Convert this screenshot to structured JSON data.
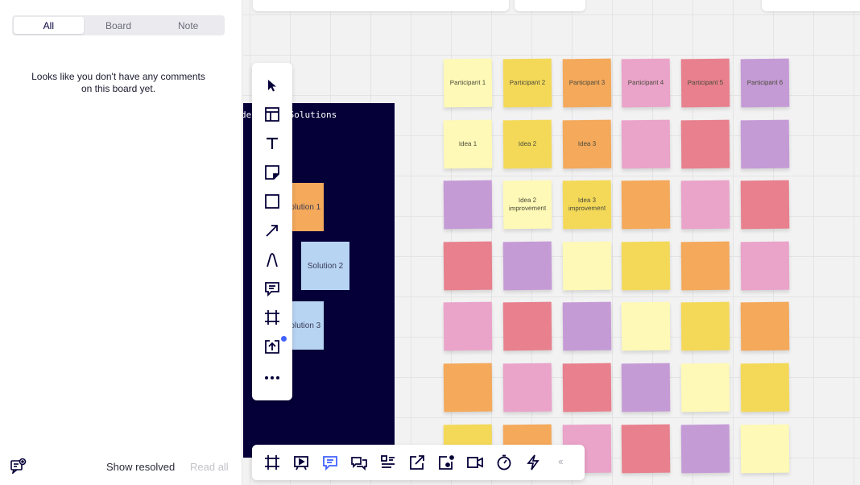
{
  "comments_panel": {
    "tabs": [
      {
        "label": "All",
        "active": true
      },
      {
        "label": "Board",
        "active": false
      },
      {
        "label": "Note",
        "active": false
      }
    ],
    "empty_message_line1": "Looks like you don't have any comments",
    "empty_message_line2": "on this board yet.",
    "show_resolved": "Show resolved",
    "read_all": "Read all"
  },
  "frame": {
    "title": "Ideas and Solutions",
    "title_visible": "deas and Solutions",
    "solutions": [
      "Solution 1",
      "Solution 2",
      "Solution 3"
    ]
  },
  "colors": {
    "light_yellow": "#fef9b6",
    "yellow": "#f4d959",
    "orange": "#f4a95b",
    "pink": "#eaa3c9",
    "red": "#e8808e",
    "violet": "#c59bd6",
    "blue": "#b7d4f3",
    "frame": "#050038",
    "accent": "#4262ff"
  },
  "sticky_grid": [
    [
      {
        "c": "light_yellow",
        "t": "Participant 1"
      },
      {
        "c": "yellow",
        "t": "Participant 2"
      },
      {
        "c": "orange",
        "t": "Participant 3"
      },
      {
        "c": "pink",
        "t": "Participant 4"
      },
      {
        "c": "red",
        "t": "Participant 5"
      },
      {
        "c": "violet",
        "t": "Participant 6"
      }
    ],
    [
      {
        "c": "light_yellow",
        "t": "Idea 1"
      },
      {
        "c": "yellow",
        "t": "Idea 2"
      },
      {
        "c": "orange",
        "t": "Idea 3"
      },
      {
        "c": "pink",
        "t": ""
      },
      {
        "c": "red",
        "t": ""
      },
      {
        "c": "violet",
        "t": ""
      }
    ],
    [
      {
        "c": "violet",
        "t": ""
      },
      {
        "c": "light_yellow",
        "t": "Idea 2 improvement"
      },
      {
        "c": "yellow",
        "t": "Idea 3 improvement"
      },
      {
        "c": "orange",
        "t": ""
      },
      {
        "c": "pink",
        "t": ""
      },
      {
        "c": "red",
        "t": ""
      }
    ],
    [
      {
        "c": "red",
        "t": ""
      },
      {
        "c": "violet",
        "t": ""
      },
      {
        "c": "light_yellow",
        "t": ""
      },
      {
        "c": "yellow",
        "t": ""
      },
      {
        "c": "orange",
        "t": ""
      },
      {
        "c": "pink",
        "t": ""
      }
    ],
    [
      {
        "c": "pink",
        "t": ""
      },
      {
        "c": "red",
        "t": ""
      },
      {
        "c": "violet",
        "t": ""
      },
      {
        "c": "light_yellow",
        "t": ""
      },
      {
        "c": "yellow",
        "t": ""
      },
      {
        "c": "orange",
        "t": ""
      }
    ],
    [
      {
        "c": "orange",
        "t": ""
      },
      {
        "c": "pink",
        "t": ""
      },
      {
        "c": "red",
        "t": ""
      },
      {
        "c": "violet",
        "t": ""
      },
      {
        "c": "light_yellow",
        "t": ""
      },
      {
        "c": "yellow",
        "t": ""
      }
    ],
    [
      {
        "c": "yellow",
        "t": ""
      },
      {
        "c": "orange",
        "t": ""
      },
      {
        "c": "pink",
        "t": ""
      },
      {
        "c": "red",
        "t": ""
      },
      {
        "c": "violet",
        "t": ""
      },
      {
        "c": "light_yellow",
        "t": ""
      }
    ]
  ],
  "vertical_toolbar": [
    "select-cursor-icon",
    "templates-icon",
    "text-icon",
    "sticky-note-icon",
    "shape-icon",
    "arrow-line-icon",
    "pen-icon",
    "comment-icon",
    "frame-icon",
    "upload-icon",
    "more-icon"
  ],
  "bottom_toolbar": [
    "frames-icon",
    "presentation-icon",
    "comments-icon",
    "chat-icon",
    "cards-icon",
    "share-screen-icon",
    "screen-record-icon",
    "video-icon",
    "timer-icon",
    "lightning-icon"
  ]
}
